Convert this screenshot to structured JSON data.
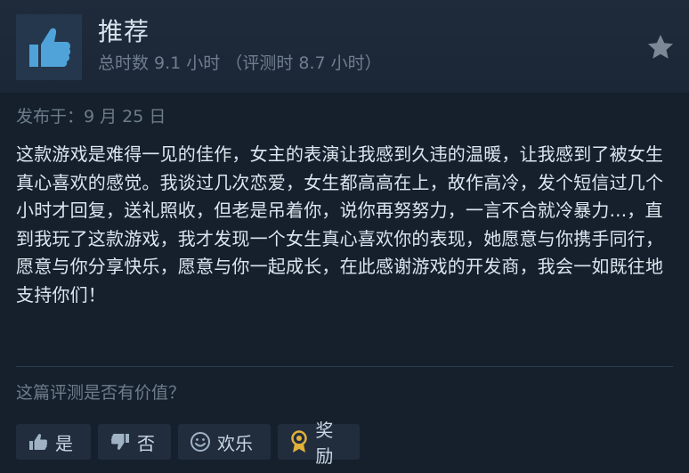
{
  "review": {
    "title": "推荐",
    "hours_text": "总时数 9.1 小时 （评测时 8.7 小时）",
    "posted": "发布于：9 月 25 日",
    "body": "这款游戏是难得一见的佳作，女主的表演让我感到久违的温暖，让我感到了被女生真心喜欢的感觉。我谈过几次恋爱，女生都高高在上，故作高冷，发个短信过几个小时才回复，送礼照收，但老是吊着你，说你再努努力，一言不合就冷暴力...，直到我玩了这款游戏，我才发现一个女生真心喜欢你的表现，她愿意与你携手同行，愿意与你分享快乐，愿意与你一起成长，在此感谢游戏的开发商，我会一如既往地支持你们！"
  },
  "helpful": {
    "question": "这篇评测是否有价值？",
    "yes_label": "是",
    "no_label": "否",
    "funny_label": "欢乐",
    "award_label": "奖励"
  },
  "icons": {
    "recommend": "thumbs-up-icon",
    "star": "star-icon",
    "yes": "thumbs-up-icon",
    "no": "thumbs-down-icon",
    "funny": "smiley-icon",
    "award": "award-medal-icon"
  },
  "colors": {
    "background": "#16202d",
    "header": "#1f2b3b",
    "thumb_blue": "#4fa3d9",
    "award_gold": "#e0b03a"
  }
}
